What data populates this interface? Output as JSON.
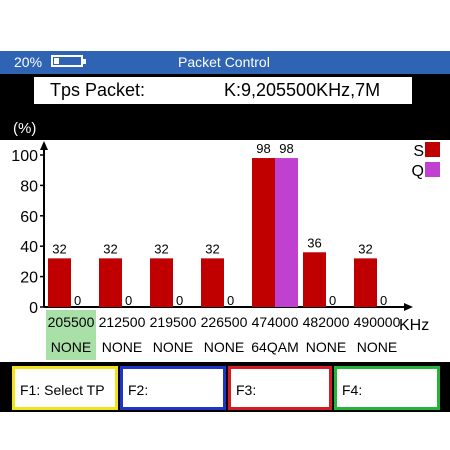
{
  "status_bar": {
    "battery_percent_text": "20%",
    "battery_level": 0.2,
    "title": "Packet Control"
  },
  "info": {
    "label": "Tps Packet:",
    "value": "K:9,205500KHz,7M"
  },
  "chart_data": {
    "type": "bar",
    "ylabel": "(%)",
    "xlabel": "KHz",
    "ylim": [
      0,
      100
    ],
    "yticks": [
      "0",
      "20",
      "40",
      "60",
      "80",
      "100"
    ],
    "categories": [
      "205500",
      "212500",
      "219500",
      "226500",
      "474000",
      "482000",
      "490000"
    ],
    "modulation": [
      "NONE",
      "NONE",
      "NONE",
      "NONE",
      "64QAM",
      "NONE",
      "NONE"
    ],
    "selected_index": 0,
    "series": [
      {
        "name": "S",
        "color": "#c00000",
        "values": [
          32,
          32,
          32,
          32,
          98,
          36,
          32
        ]
      },
      {
        "name": "Q",
        "color": "#c040d0",
        "values": [
          0,
          0,
          0,
          0,
          98,
          0,
          0
        ]
      }
    ],
    "legend_position": "top-right"
  },
  "function_keys": {
    "f1": "F1:  Select TP",
    "f2": "F2:",
    "f3": "F3:",
    "f4": "F4:"
  }
}
